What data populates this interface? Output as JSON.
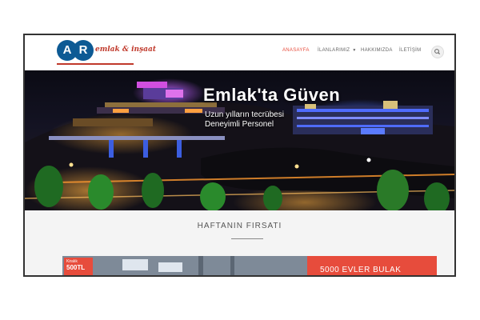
{
  "logo": {
    "letters": [
      "A",
      "R"
    ],
    "tagline": "emlak & inşaat"
  },
  "nav": {
    "items": [
      {
        "label": "ANASAYFA",
        "active": true
      },
      {
        "label": "İLANLARIMIZ",
        "dropdown": true
      },
      {
        "label": "HAKKIMIZDA"
      },
      {
        "label": "İLETİŞİM"
      }
    ],
    "search_icon": "search-icon"
  },
  "hero": {
    "title": "Emlak'ta Güven",
    "subtitle_line1": "Uzun yılların tecrübesi",
    "subtitle_line2": "Deneyimli Personel"
  },
  "section": {
    "title": "HAFTANIN FIRSATI",
    "badge_label": "Kiralık",
    "badge_price": "500TL",
    "promo_text": "5000 EVLER BULAK"
  },
  "colors": {
    "accent": "#e74c3c",
    "brand": "#0d5a94"
  }
}
